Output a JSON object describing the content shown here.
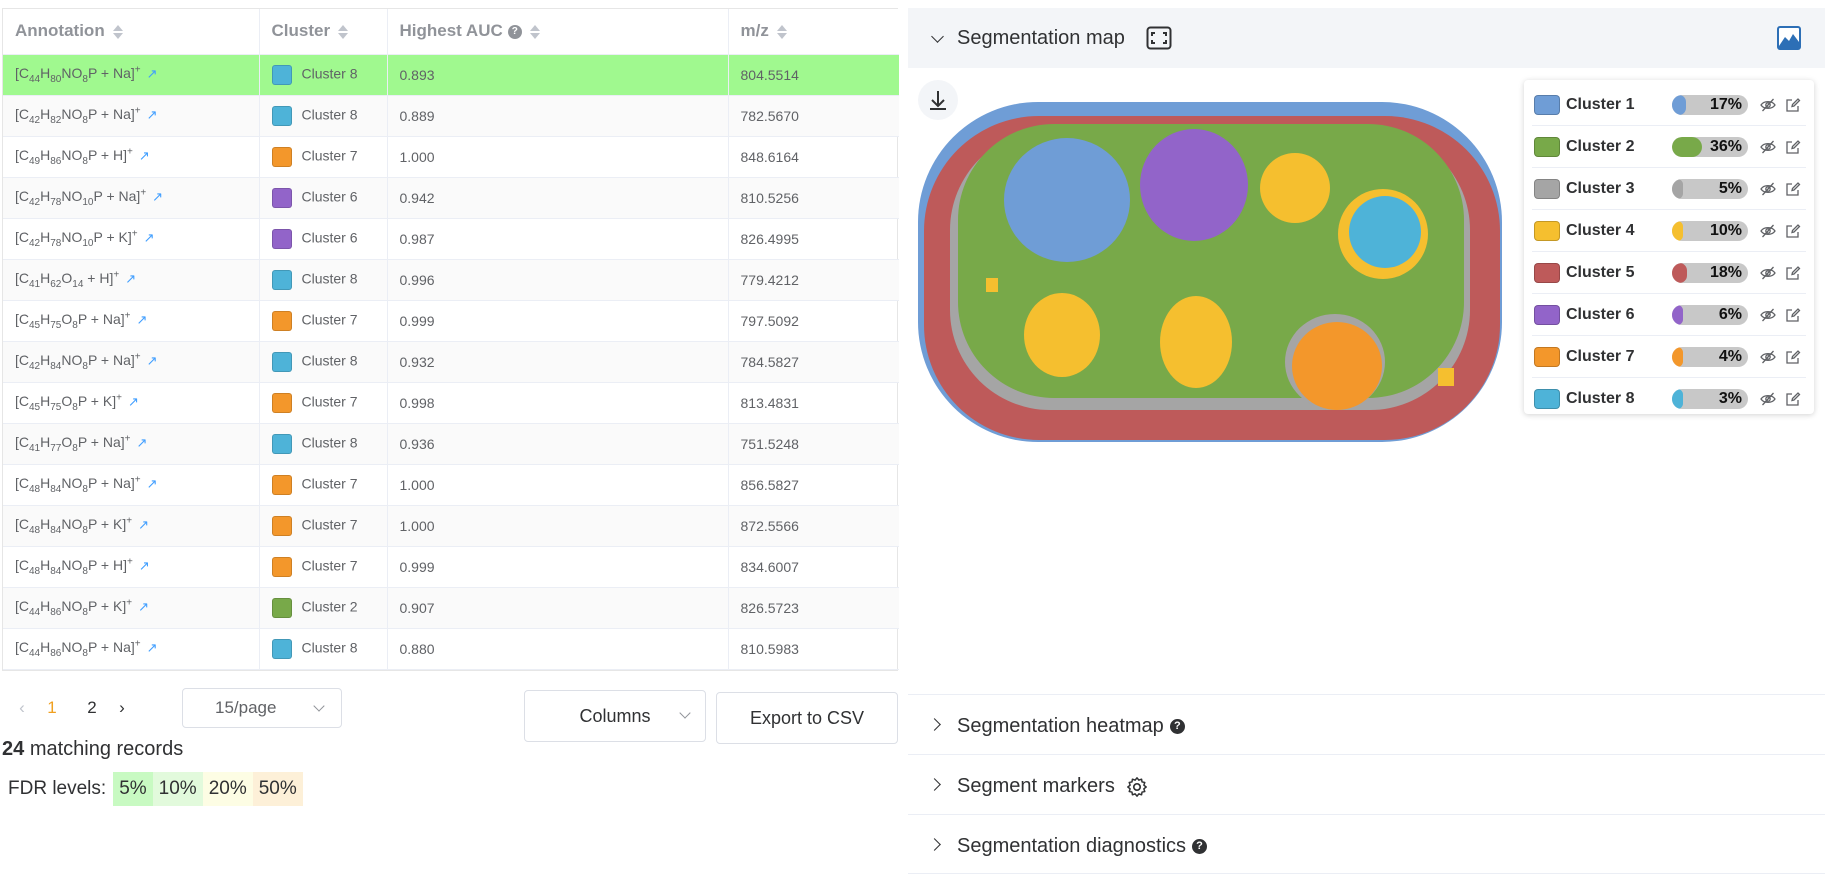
{
  "table": {
    "headers": {
      "annotation": "Annotation",
      "cluster": "Cluster",
      "auc": "Highest AUC",
      "mz": "m/z"
    },
    "rows": [
      {
        "f": [
          [
            "[C",
            ""
          ],
          [
            "44",
            "s"
          ],
          [
            "H",
            ""
          ],
          [
            "80",
            "s"
          ],
          [
            "NO",
            ""
          ],
          [
            "8",
            "s"
          ],
          [
            "P + Na]",
            ""
          ],
          [
            "+",
            "p"
          ]
        ],
        "cluster": "Cluster 8",
        "cluster_color": "#4eb3d8",
        "auc": "0.893",
        "mz": "804.5514"
      },
      {
        "f": [
          [
            "[C",
            ""
          ],
          [
            "42",
            "s"
          ],
          [
            "H",
            ""
          ],
          [
            "82",
            "s"
          ],
          [
            "NO",
            ""
          ],
          [
            "8",
            "s"
          ],
          [
            "P + Na]",
            ""
          ],
          [
            "+",
            "p"
          ]
        ],
        "cluster": "Cluster 8",
        "cluster_color": "#4eb3d8",
        "auc": "0.889",
        "mz": "782.5670"
      },
      {
        "f": [
          [
            "[C",
            ""
          ],
          [
            "49",
            "s"
          ],
          [
            "H",
            ""
          ],
          [
            "86",
            "s"
          ],
          [
            "NO",
            ""
          ],
          [
            "8",
            "s"
          ],
          [
            "P + H]",
            ""
          ],
          [
            "+",
            "p"
          ]
        ],
        "cluster": "Cluster 7",
        "cluster_color": "#f3972b",
        "auc": "1.000",
        "mz": "848.6164"
      },
      {
        "f": [
          [
            "[C",
            ""
          ],
          [
            "42",
            "s"
          ],
          [
            "H",
            ""
          ],
          [
            "78",
            "s"
          ],
          [
            "NO",
            ""
          ],
          [
            "10",
            "s"
          ],
          [
            "P + Na]",
            ""
          ],
          [
            "+",
            "p"
          ]
        ],
        "cluster": "Cluster 6",
        "cluster_color": "#9264c9",
        "auc": "0.942",
        "mz": "810.5256"
      },
      {
        "f": [
          [
            "[C",
            ""
          ],
          [
            "42",
            "s"
          ],
          [
            "H",
            ""
          ],
          [
            "78",
            "s"
          ],
          [
            "NO",
            ""
          ],
          [
            "10",
            "s"
          ],
          [
            "P + K]",
            ""
          ],
          [
            "+",
            "p"
          ]
        ],
        "cluster": "Cluster 6",
        "cluster_color": "#9264c9",
        "auc": "0.987",
        "mz": "826.4995"
      },
      {
        "f": [
          [
            "[C",
            ""
          ],
          [
            "41",
            "s"
          ],
          [
            "H",
            ""
          ],
          [
            "62",
            "s"
          ],
          [
            "O",
            ""
          ],
          [
            "14",
            "s"
          ],
          [
            " + H]",
            ""
          ],
          [
            "+",
            "p"
          ]
        ],
        "cluster": "Cluster 8",
        "cluster_color": "#4eb3d8",
        "auc": "0.996",
        "mz": "779.4212"
      },
      {
        "f": [
          [
            "[C",
            ""
          ],
          [
            "45",
            "s"
          ],
          [
            "H",
            ""
          ],
          [
            "75",
            "s"
          ],
          [
            "O",
            ""
          ],
          [
            "8",
            "s"
          ],
          [
            "P + Na]",
            ""
          ],
          [
            "+",
            "p"
          ]
        ],
        "cluster": "Cluster 7",
        "cluster_color": "#f3972b",
        "auc": "0.999",
        "mz": "797.5092"
      },
      {
        "f": [
          [
            "[C",
            ""
          ],
          [
            "42",
            "s"
          ],
          [
            "H",
            ""
          ],
          [
            "84",
            "s"
          ],
          [
            "NO",
            ""
          ],
          [
            "8",
            "s"
          ],
          [
            "P + Na]",
            ""
          ],
          [
            "+",
            "p"
          ]
        ],
        "cluster": "Cluster 8",
        "cluster_color": "#4eb3d8",
        "auc": "0.932",
        "mz": "784.5827"
      },
      {
        "f": [
          [
            "[C",
            ""
          ],
          [
            "45",
            "s"
          ],
          [
            "H",
            ""
          ],
          [
            "75",
            "s"
          ],
          [
            "O",
            ""
          ],
          [
            "8",
            "s"
          ],
          [
            "P + K]",
            ""
          ],
          [
            "+",
            "p"
          ]
        ],
        "cluster": "Cluster 7",
        "cluster_color": "#f3972b",
        "auc": "0.998",
        "mz": "813.4831"
      },
      {
        "f": [
          [
            "[C",
            ""
          ],
          [
            "41",
            "s"
          ],
          [
            "H",
            ""
          ],
          [
            "77",
            "s"
          ],
          [
            "O",
            ""
          ],
          [
            "8",
            "s"
          ],
          [
            "P + Na]",
            ""
          ],
          [
            "+",
            "p"
          ]
        ],
        "cluster": "Cluster 8",
        "cluster_color": "#4eb3d8",
        "auc": "0.936",
        "mz": "751.5248"
      },
      {
        "f": [
          [
            "[C",
            ""
          ],
          [
            "48",
            "s"
          ],
          [
            "H",
            ""
          ],
          [
            "84",
            "s"
          ],
          [
            "NO",
            ""
          ],
          [
            "8",
            "s"
          ],
          [
            "P + Na]",
            ""
          ],
          [
            "+",
            "p"
          ]
        ],
        "cluster": "Cluster 7",
        "cluster_color": "#f3972b",
        "auc": "1.000",
        "mz": "856.5827"
      },
      {
        "f": [
          [
            "[C",
            ""
          ],
          [
            "48",
            "s"
          ],
          [
            "H",
            ""
          ],
          [
            "84",
            "s"
          ],
          [
            "NO",
            ""
          ],
          [
            "8",
            "s"
          ],
          [
            "P + K]",
            ""
          ],
          [
            "+",
            "p"
          ]
        ],
        "cluster": "Cluster 7",
        "cluster_color": "#f3972b",
        "auc": "1.000",
        "mz": "872.5566"
      },
      {
        "f": [
          [
            "[C",
            ""
          ],
          [
            "48",
            "s"
          ],
          [
            "H",
            ""
          ],
          [
            "84",
            "s"
          ],
          [
            "NO",
            ""
          ],
          [
            "8",
            "s"
          ],
          [
            "P + H]",
            ""
          ],
          [
            "+",
            "p"
          ]
        ],
        "cluster": "Cluster 7",
        "cluster_color": "#f3972b",
        "auc": "0.999",
        "mz": "834.6007"
      },
      {
        "f": [
          [
            "[C",
            ""
          ],
          [
            "44",
            "s"
          ],
          [
            "H",
            ""
          ],
          [
            "86",
            "s"
          ],
          [
            "NO",
            ""
          ],
          [
            "8",
            "s"
          ],
          [
            "P + K]",
            ""
          ],
          [
            "+",
            "p"
          ]
        ],
        "cluster": "Cluster 2",
        "cluster_color": "#78a949",
        "auc": "0.907",
        "mz": "826.5723"
      },
      {
        "f": [
          [
            "[C",
            ""
          ],
          [
            "44",
            "s"
          ],
          [
            "H",
            ""
          ],
          [
            "86",
            "s"
          ],
          [
            "NO",
            ""
          ],
          [
            "8",
            "s"
          ],
          [
            "P + Na]",
            ""
          ],
          [
            "+",
            "p"
          ]
        ],
        "cluster": "Cluster 8",
        "cluster_color": "#4eb3d8",
        "auc": "0.880",
        "mz": "810.5983"
      }
    ],
    "selected_row": 0
  },
  "pagination": {
    "pages": [
      "1",
      "2"
    ],
    "current": "1",
    "page_size": "15/page"
  },
  "buttons": {
    "columns": "Columns",
    "export": "Export to CSV"
  },
  "records": {
    "count": "24",
    "label": "matching records"
  },
  "fdr": {
    "label": "FDR levels:",
    "levels": [
      {
        "text": "5%",
        "color": "#c8fac2"
      },
      {
        "text": "10%",
        "color": "#e2fadc"
      },
      {
        "text": "20%",
        "color": "#fdfde4"
      },
      {
        "text": "50%",
        "color": "#fdf0d8"
      }
    ]
  },
  "sections": {
    "seg_map": "Segmentation map",
    "heatmap": "Segmentation heatmap",
    "markers": "Segment markers",
    "diagnostics": "Segmentation diagnostics"
  },
  "legend": [
    {
      "name": "Cluster 1",
      "color": "#6f9dd6",
      "pct": "17%",
      "value": 17
    },
    {
      "name": "Cluster 2",
      "color": "#78a949",
      "pct": "36%",
      "value": 36
    },
    {
      "name": "Cluster 3",
      "color": "#a5a5a5",
      "pct": "5%",
      "value": 5
    },
    {
      "name": "Cluster 4",
      "color": "#f5bf2f",
      "pct": "10%",
      "value": 10
    },
    {
      "name": "Cluster 5",
      "color": "#be5a5a",
      "pct": "18%",
      "value": 18
    },
    {
      "name": "Cluster 6",
      "color": "#9264c9",
      "pct": "6%",
      "value": 6
    },
    {
      "name": "Cluster 7",
      "color": "#f3972b",
      "pct": "4%",
      "value": 4
    },
    {
      "name": "Cluster 8",
      "color": "#4eb3d8",
      "pct": "3%",
      "value": 3
    }
  ]
}
